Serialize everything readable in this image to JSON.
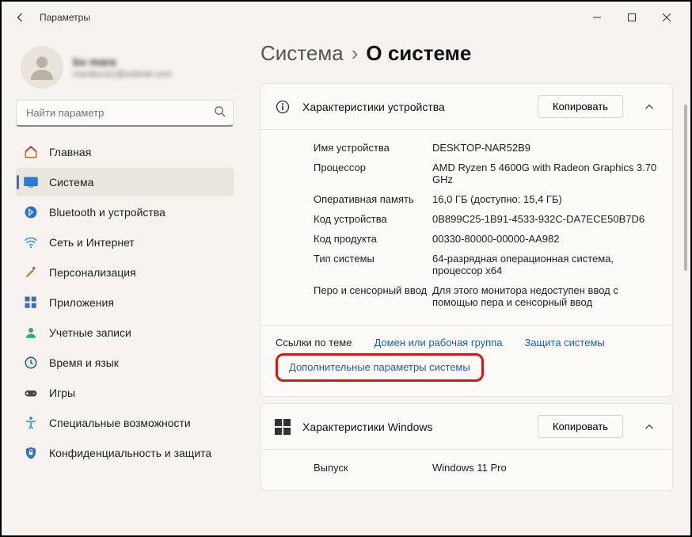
{
  "titlebar": {
    "title": "Параметры"
  },
  "user": {
    "name": "bo mara",
    "email": "marabu111@outlook.com"
  },
  "search": {
    "placeholder": "Найти параметр"
  },
  "sidebar": {
    "items": [
      {
        "label": "Главная"
      },
      {
        "label": "Система"
      },
      {
        "label": "Bluetooth и устройства"
      },
      {
        "label": "Сеть и Интернет"
      },
      {
        "label": "Персонализация"
      },
      {
        "label": "Приложения"
      },
      {
        "label": "Учетные записи"
      },
      {
        "label": "Время и язык"
      },
      {
        "label": "Игры"
      },
      {
        "label": "Специальные возможности"
      },
      {
        "label": "Конфиденциальность и защита"
      }
    ]
  },
  "breadcrumb": {
    "parent": "Система",
    "current": "О системе"
  },
  "device_card": {
    "title": "Характеристики устройства",
    "copy": "Копировать",
    "specs": [
      {
        "k": "Имя устройства",
        "v": "DESKTOP-NAR52B9"
      },
      {
        "k": "Процессор",
        "v": "AMD Ryzen 5 4600G with Radeon Graphics    3.70 GHz"
      },
      {
        "k": "Оперативная память",
        "v": "16,0 ГБ (доступно: 15,4 ГБ)"
      },
      {
        "k": "Код устройства",
        "v": "0B899C25-1B91-4533-932C-DA7ECE50B7D6"
      },
      {
        "k": "Код продукта",
        "v": "00330-80000-00000-AA982"
      },
      {
        "k": "Тип системы",
        "v": "64-разрядная операционная система, процессор x64"
      },
      {
        "k": "Перо и сенсорный ввод",
        "v": "Для этого монитора недоступен ввод с помощью пера и сенсорный ввод"
      }
    ],
    "links_label": "Ссылки по теме",
    "links": [
      "Домен или рабочая группа",
      "Защита системы",
      "Дополнительные параметры системы"
    ]
  },
  "windows_card": {
    "title": "Характеристики Windows",
    "copy": "Копировать",
    "specs": [
      {
        "k": "Выпуск",
        "v": "Windows 11 Pro"
      }
    ]
  }
}
